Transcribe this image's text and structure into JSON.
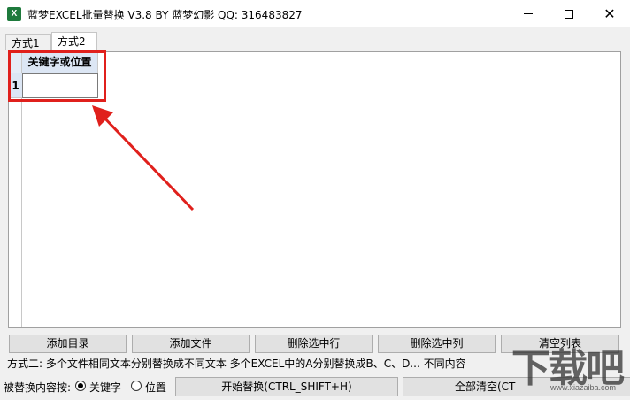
{
  "window": {
    "title": "蓝梦EXCEL批量替换 V3.8 BY 蓝梦幻影 QQ: 316483827",
    "icon_letter": "X",
    "controls": [
      "minimize",
      "maximize",
      "close"
    ],
    "close_glyph": "✕"
  },
  "tabs": [
    {
      "label": "方式1",
      "active": false
    },
    {
      "label": "方式2",
      "active": true
    }
  ],
  "grid": {
    "column_header": "关键字或位置",
    "rows": [
      {
        "number": "1",
        "value": ""
      }
    ]
  },
  "buttons": {
    "add_folder": "添加目录",
    "add_file": "添加文件",
    "delete_row": "删除选中行",
    "delete_col": "删除选中列",
    "clear_list": "清空列表",
    "start_replace": "开始替换(CTRL_SHIFT+H)",
    "clear_all": "全部清空(CT"
  },
  "info_text": "方式二: 多个文件相同文本分别替换成不同文本  多个EXCEL中的A分别替换成B、C、D...  不同内容",
  "replace_by": {
    "label": "被替换内容按:",
    "options": [
      {
        "label": "关键字",
        "selected": true
      },
      {
        "label": "位置",
        "selected": false
      }
    ]
  },
  "watermark": {
    "logo_text": "下载吧",
    "url_text": "www.xiazaiba.com"
  },
  "annotation": {
    "highlight_color": "#e0201c"
  }
}
